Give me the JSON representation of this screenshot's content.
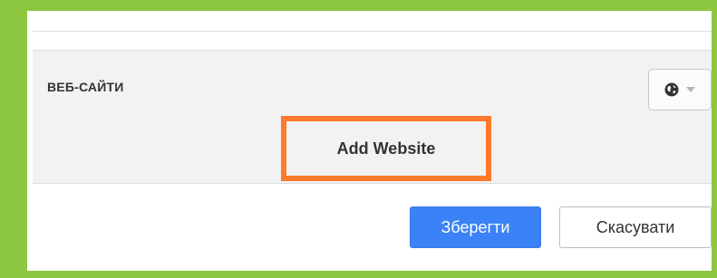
{
  "section": {
    "title": "ВЕБ-САЙТИ",
    "visibility_icon": "globe-icon"
  },
  "add_website": {
    "label": "Add Website",
    "highlight_color": "#ff7a2b"
  },
  "actions": {
    "save_label": "Зберегти",
    "cancel_label": "Скасувати"
  },
  "colors": {
    "frame": "#8dc63f",
    "primary": "#3b82f6",
    "section_bg": "#f2f2f2"
  }
}
